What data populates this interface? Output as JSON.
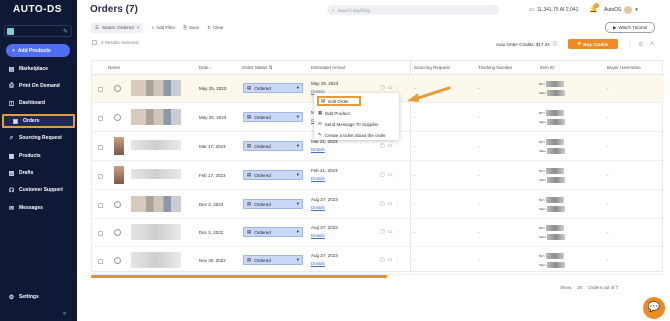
{
  "sidebar": {
    "logo": "AUTO-DS",
    "add_products": "Add Products",
    "items": [
      {
        "label": "Marketplace"
      },
      {
        "label": "Print On Demand"
      },
      {
        "label": "Dashboard"
      },
      {
        "label": "Orders"
      },
      {
        "label": "Sourcing Request"
      },
      {
        "label": "Products"
      },
      {
        "label": "Drafts"
      },
      {
        "label": "Customer Support"
      },
      {
        "label": "Messages"
      }
    ],
    "settings": "Settings"
  },
  "header": {
    "title": "Orders (7)",
    "search_placeholder": "Search anything",
    "credits": "11,341.75 AI 2,041",
    "notifications": "1",
    "user": "AutoDS",
    "watch_tutorial": "Watch Tutorial"
  },
  "filters": {
    "status_chip": "Status: Ordered",
    "add_filter": "Add Filter",
    "save": "Save",
    "clear": "Clear"
  },
  "toolbar": {
    "results_selected": "0 Results Selected",
    "auto_order_credits": "Auto Order Credits: $17.34",
    "buy_credits": "Buy Credits"
  },
  "table": {
    "columns": [
      "Name",
      "Date",
      "Order Status",
      "Estimated Arrival",
      "Sourcing Request",
      "Tracking Number",
      "Item ID",
      "Buyer Username"
    ],
    "rows": [
      {
        "date": "May 25, 2023",
        "status": "Ordered",
        "arrival": "May 29, 2023",
        "link": "Details",
        "source": "-",
        "tracking": "-",
        "buyer": "-"
      },
      {
        "date": "May 25, 2023",
        "status": "Ordered",
        "arrival": "May 29, 2023",
        "link": "Details",
        "source": "-",
        "tracking": "-",
        "buyer": "-"
      },
      {
        "date": "Mar 17, 2023",
        "status": "Ordered",
        "arrival": "Mar 21, 2023",
        "link": "Details",
        "source": "-",
        "tracking": "-",
        "buyer": "-"
      },
      {
        "date": "Feb 17, 2023",
        "status": "Ordered",
        "arrival": "Feb 21, 2023",
        "link": "Details",
        "source": "-",
        "tracking": "-",
        "buyer": "-"
      },
      {
        "date": "Dec 2, 2022",
        "status": "Ordered",
        "arrival": "Aug 27, 2023",
        "link": "Details",
        "source": "-",
        "tracking": "-",
        "buyer": "-"
      },
      {
        "date": "Dec 2, 2022",
        "status": "Ordered",
        "arrival": "Aug 27, 2023",
        "link": "Details",
        "source": "-",
        "tracking": "-",
        "buyer": "-"
      },
      {
        "date": "Nov 30, 2022",
        "status": "Ordered",
        "arrival": "Aug 27, 2023",
        "link": "Details",
        "source": "-",
        "tracking": "-",
        "buyer": "-"
      }
    ],
    "buy_label": "BUY",
    "sell_label": "SELL"
  },
  "context_menu": {
    "edit_order": "Edit Order",
    "edit_product": "Edit Product",
    "send_message": "Send Message To Supplier",
    "create_ticket": "Create a ticket about the order"
  },
  "footer": {
    "show_label": "Show",
    "page_size": "20",
    "orders_count": "Orders out of 7"
  },
  "colors": {
    "sidebar": "#0f1835",
    "accent": "#f08a24",
    "primary": "#4e6ff5",
    "highlight": "#e59b3a"
  }
}
